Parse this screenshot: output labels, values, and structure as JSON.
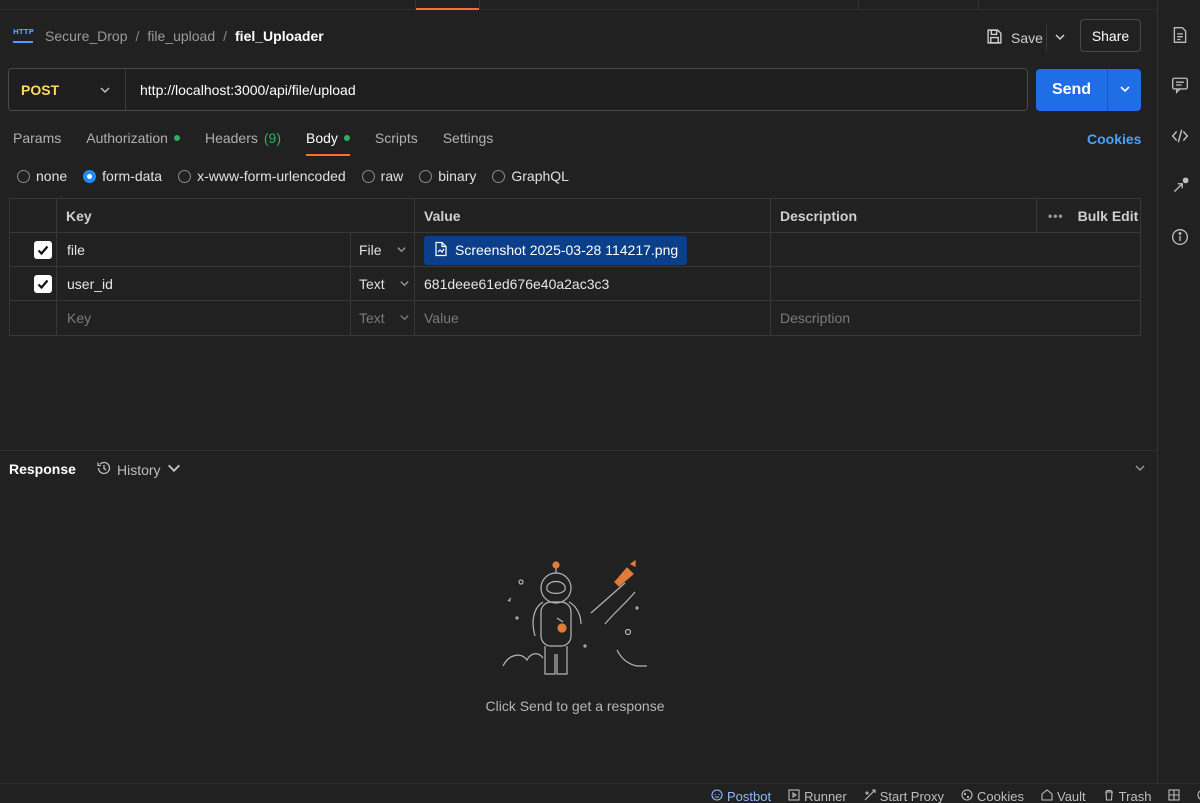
{
  "breadcrumb": {
    "workspace": "Secure_Drop",
    "collection": "file_upload",
    "request": "fiel_Uploader",
    "separator": "/"
  },
  "header": {
    "save_label": "Save",
    "share_label": "Share"
  },
  "request": {
    "method": "POST",
    "url": "http://localhost:3000/api/file/upload",
    "send_label": "Send"
  },
  "tabs": [
    {
      "label": "Params"
    },
    {
      "label": "Authorization"
    },
    {
      "label": "Headers",
      "count": "(9)"
    },
    {
      "label": "Body"
    },
    {
      "label": "Scripts"
    },
    {
      "label": "Settings"
    }
  ],
  "cookies_label": "Cookies",
  "body_types": [
    "none",
    "form-data",
    "x-www-form-urlencoded",
    "raw",
    "binary",
    "GraphQL"
  ],
  "body_type_selected": "form-data",
  "table": {
    "headers": {
      "key": "Key",
      "value": "Value",
      "description": "Description",
      "bulk_edit": "Bulk Edit"
    },
    "rows": [
      {
        "key": "file",
        "type": "File",
        "value": "Screenshot 2025-03-28 114217.png",
        "checked": true
      },
      {
        "key": "user_id",
        "type": "Text",
        "value": "681deee61ed676e40a2ac3c3",
        "checked": true
      }
    ],
    "empty_row": {
      "key": "Key",
      "type": "Text",
      "value": "Value",
      "description": "Description"
    }
  },
  "response": {
    "title": "Response",
    "history_label": "History",
    "empty_message": "Click Send to get a response"
  },
  "footer": [
    "Postbot",
    "Runner",
    "Start Proxy",
    "Cookies",
    "Vault",
    "Trash"
  ],
  "colors": {
    "accent": "#ff6c37",
    "send": "#1f6ee6",
    "method": "#ffd85f",
    "status_dot": "#26b35e",
    "link": "#4ea0ff"
  }
}
